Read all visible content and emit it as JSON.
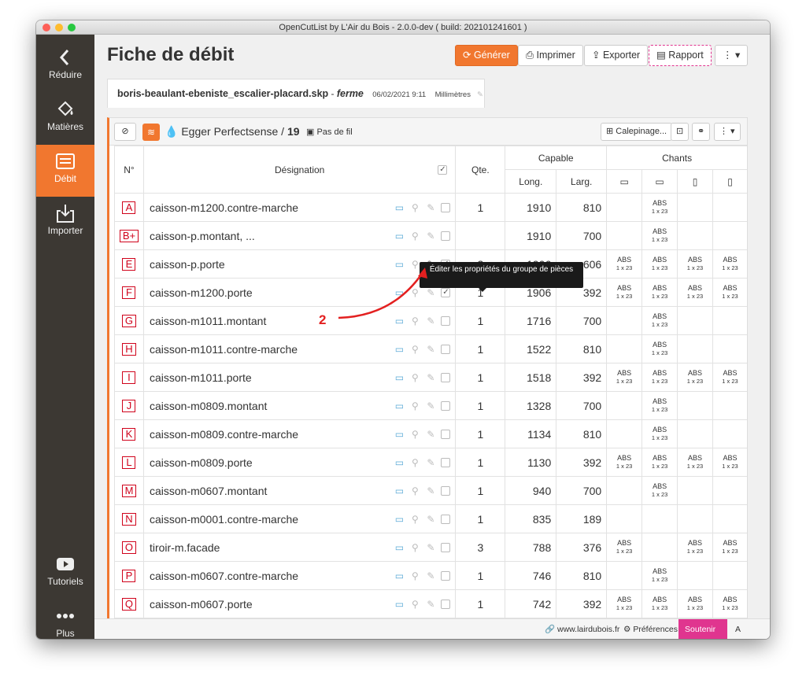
{
  "window": {
    "title": "OpenCutList by L'Air du Bois - 2.0.0-dev ( build: 202101241601 )"
  },
  "sidebar": {
    "reduce": "Réduire",
    "materials": "Matières",
    "cutlist": "Débit",
    "import": "Importer",
    "tutorials": "Tutoriels",
    "more": "Plus"
  },
  "header": {
    "title": "Fiche de débit",
    "generate": "Générer",
    "print": "Imprimer",
    "export": "Exporter",
    "report": "Rapport"
  },
  "tab": {
    "filename": "boris-beaulant-ebeniste_escalier-placard.skp",
    "model": "ferme",
    "date": "06/02/2021 9:11",
    "unit": "Millimètres"
  },
  "group": {
    "material": "Egger Perfectsense / ",
    "count": "19",
    "grain": "Pas de fil",
    "calepinage": "Calepinage..."
  },
  "columns": {
    "num": "N°",
    "designation": "Désignation",
    "qty": "Qte.",
    "capable": "Capable",
    "length": "Long.",
    "width": "Larg.",
    "edges": "Chants"
  },
  "rows": [
    {
      "num": "A",
      "name": "caisson-m1200.contre-marche",
      "qty": "1",
      "length": "1910",
      "width": "810",
      "edges": [
        "",
        "ABS|1 x 23",
        "",
        ""
      ],
      "checked": false
    },
    {
      "num": "B+",
      "name": "caisson-p.montant, ...",
      "qty": "",
      "length": "1910",
      "width": "700",
      "edges": [
        "",
        "ABS|1 x 23",
        "",
        ""
      ],
      "checked": false
    },
    {
      "num": "E",
      "name": "caisson-p.porte",
      "qty": "2",
      "length": "1906",
      "width": "606",
      "edges": [
        "ABS|1 x 23",
        "ABS|1 x 23",
        "ABS|1 x 23",
        "ABS|1 x 23"
      ],
      "checked": true
    },
    {
      "num": "F",
      "name": "caisson-m1200.porte",
      "qty": "1",
      "length": "1906",
      "width": "392",
      "edges": [
        "ABS|1 x 23",
        "ABS|1 x 23",
        "ABS|1 x 23",
        "ABS|1 x 23"
      ],
      "checked": true
    },
    {
      "num": "G",
      "name": "caisson-m1011.montant",
      "qty": "1",
      "length": "1716",
      "width": "700",
      "edges": [
        "",
        "ABS|1 x 23",
        "",
        ""
      ],
      "checked": false
    },
    {
      "num": "H",
      "name": "caisson-m1011.contre-marche",
      "qty": "1",
      "length": "1522",
      "width": "810",
      "edges": [
        "",
        "ABS|1 x 23",
        "",
        ""
      ],
      "checked": false
    },
    {
      "num": "I",
      "name": "caisson-m1011.porte",
      "qty": "1",
      "length": "1518",
      "width": "392",
      "edges": [
        "ABS|1 x 23",
        "ABS|1 x 23",
        "ABS|1 x 23",
        "ABS|1 x 23"
      ],
      "checked": false
    },
    {
      "num": "J",
      "name": "caisson-m0809.montant",
      "qty": "1",
      "length": "1328",
      "width": "700",
      "edges": [
        "",
        "ABS|1 x 23",
        "",
        ""
      ],
      "checked": false
    },
    {
      "num": "K",
      "name": "caisson-m0809.contre-marche",
      "qty": "1",
      "length": "1134",
      "width": "810",
      "edges": [
        "",
        "ABS|1 x 23",
        "",
        ""
      ],
      "checked": false
    },
    {
      "num": "L",
      "name": "caisson-m0809.porte",
      "qty": "1",
      "length": "1130",
      "width": "392",
      "edges": [
        "ABS|1 x 23",
        "ABS|1 x 23",
        "ABS|1 x 23",
        "ABS|1 x 23"
      ],
      "checked": false
    },
    {
      "num": "M",
      "name": "caisson-m0607.montant",
      "qty": "1",
      "length": "940",
      "width": "700",
      "edges": [
        "",
        "ABS|1 x 23",
        "",
        ""
      ],
      "checked": false
    },
    {
      "num": "N",
      "name": "caisson-m0001.contre-marche",
      "qty": "1",
      "length": "835",
      "width": "189",
      "edges": [
        "",
        "",
        "",
        ""
      ],
      "checked": false
    },
    {
      "num": "O",
      "name": "tiroir-m.facade",
      "qty": "3",
      "length": "788",
      "width": "376",
      "edges": [
        "ABS|1 x 23",
        "",
        "ABS|1 x 23",
        "ABS|1 x 23"
      ],
      "checked": false
    },
    {
      "num": "P",
      "name": "caisson-m0607.contre-marche",
      "qty": "1",
      "length": "746",
      "width": "810",
      "edges": [
        "",
        "ABS|1 x 23",
        "",
        ""
      ],
      "checked": false
    },
    {
      "num": "Q",
      "name": "caisson-m0607.porte",
      "qty": "1",
      "length": "742",
      "width": "392",
      "edges": [
        "ABS|1 x 23",
        "ABS|1 x 23",
        "ABS|1 x 23",
        "ABS|1 x 23"
      ],
      "checked": false
    }
  ],
  "tooltip": "Éditer les propriétés du groupe de pièces",
  "annotation": "2",
  "footer": {
    "site": "www.lairdubois.fr",
    "prefs": "Préférences",
    "support": "Soutenir",
    "about": "A propos"
  },
  "colors": {
    "accent": "#f1772f",
    "sidebar": "#3c3833",
    "red": "#d0021b",
    "pink": "#e0358f"
  }
}
